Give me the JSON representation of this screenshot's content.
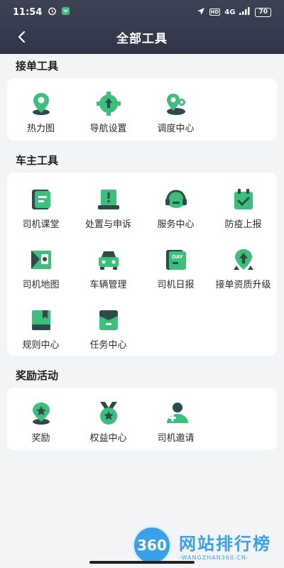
{
  "status_bar": {
    "time": "11:54",
    "network": "4G",
    "battery": "70"
  },
  "header": {
    "title": "全部工具"
  },
  "sections": [
    {
      "title": "接单工具",
      "items": [
        {
          "label": "热力图",
          "icon": "map-pin-icon"
        },
        {
          "label": "导航设置",
          "icon": "gear-arrow-icon"
        },
        {
          "label": "调度中心",
          "icon": "dispatch-icon"
        }
      ]
    },
    {
      "title": "车主工具",
      "items": [
        {
          "label": "司机课堂",
          "icon": "book-icon"
        },
        {
          "label": "处置与申诉",
          "icon": "alert-monitor-icon"
        },
        {
          "label": "服务中心",
          "icon": "headset-icon"
        },
        {
          "label": "防疫上报",
          "icon": "calendar-check-icon"
        },
        {
          "label": "司机地图",
          "icon": "map-icon"
        },
        {
          "label": "车辆管理",
          "icon": "car-icon"
        },
        {
          "label": "司机日报",
          "icon": "day-report-icon"
        },
        {
          "label": "接单资质升级",
          "icon": "badge-upgrade-icon"
        },
        {
          "label": "规则中心",
          "icon": "rule-book-icon"
        },
        {
          "label": "任务中心",
          "icon": "task-icon"
        }
      ]
    },
    {
      "title": "奖励活动",
      "items": [
        {
          "label": "奖励",
          "icon": "star-pin-icon"
        },
        {
          "label": "权益中心",
          "icon": "medal-icon"
        },
        {
          "label": "司机邀请",
          "icon": "invite-user-icon"
        }
      ]
    }
  ],
  "watermark": {
    "badge": "360",
    "main": "网站排行榜",
    "sub": "-WANGZHAN360.CN-"
  },
  "colors": {
    "header": "#383d50",
    "accent": "#3cbf7b",
    "dark": "#2f4a4a"
  }
}
